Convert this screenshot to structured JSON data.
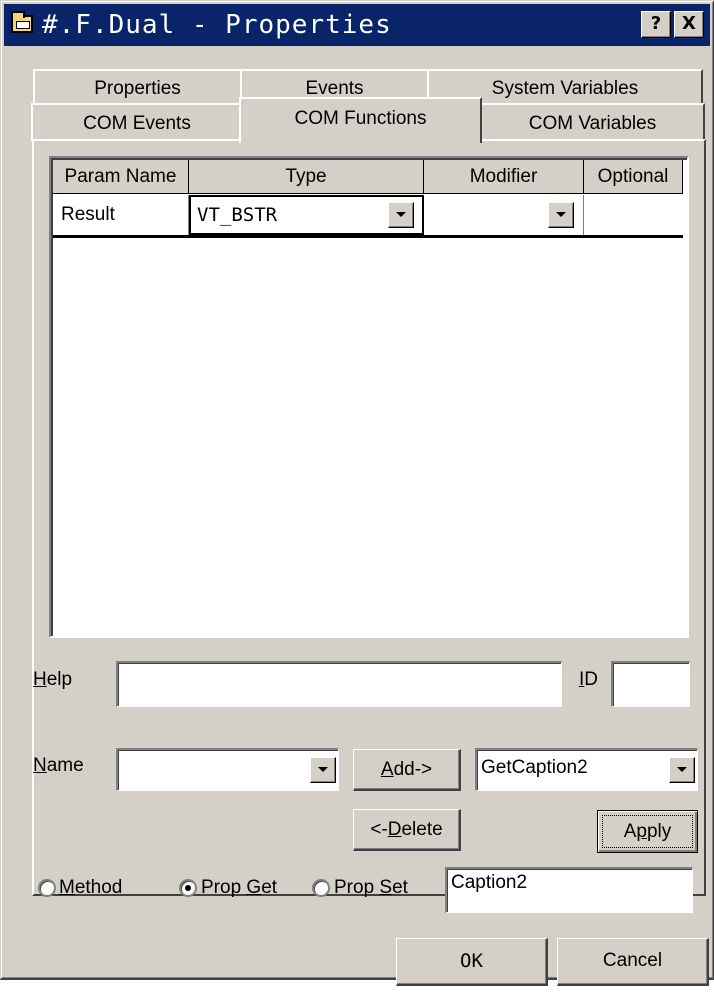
{
  "window": {
    "title": "#.F.Dual - Properties",
    "help_button": "?",
    "close_button": "X"
  },
  "tabs": {
    "row1": [
      "Properties",
      "Events",
      "System Variables"
    ],
    "row2": [
      "COM Events",
      "COM Functions",
      "COM Variables"
    ],
    "active": "COM Functions"
  },
  "grid": {
    "columns": [
      "Param Name",
      "Type",
      "Modifier",
      "Optional"
    ],
    "rows": [
      {
        "param_name": "Result",
        "type": "VT_BSTR",
        "modifier": "",
        "optional": ""
      }
    ]
  },
  "form": {
    "help_label_u": "H",
    "help_label_rest": "elp",
    "help_value": "",
    "id_label_u": "I",
    "id_label_rest": "D",
    "id_value": "",
    "name_label_u": "N",
    "name_label_rest": "ame",
    "name_value": "",
    "add_u": "A",
    "add_rest": "dd->",
    "delete_pre": "<-",
    "delete_u": "D",
    "delete_rest": "elete",
    "function_select": "GetCaption2",
    "apply_pre": "A",
    "apply_u": "p",
    "apply_rest": "ply",
    "radio_method_u": "M",
    "radio_method_rest": "ethod",
    "radio_propget_pre": "Prop ",
    "radio_propget_u": "G",
    "radio_propget_rest": "et",
    "radio_propset_pre": "Prop ",
    "radio_propset_u": "S",
    "radio_propset_rest": "et",
    "selected_radio": "Prop Get",
    "caption_value": "Caption2"
  },
  "footer": {
    "ok_label": "OK",
    "cancel_label": "Cancel"
  },
  "colors": {
    "titlebar": "#0a246a",
    "face": "#d4d0c8"
  }
}
